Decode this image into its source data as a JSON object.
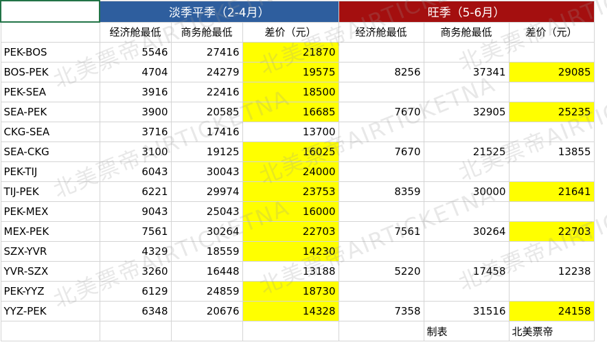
{
  "sheet": {
    "off_season_title": "淡季平季（2-4月）",
    "peak_season_title": "旺季（5-6月）",
    "headers": {
      "off": [
        "经济舱最低",
        "商务舱最低",
        "差价（元）"
      ],
      "peak": [
        "经济舱最低",
        "商务舱最低",
        "差价（元）"
      ]
    },
    "rows": [
      {
        "route": "PEK-BOS",
        "off": [
          "5546",
          "27416",
          "21870"
        ],
        "peak": [
          "",
          "",
          ""
        ]
      },
      {
        "route": "BOS-PEK",
        "off": [
          "4704",
          "24279",
          "19575"
        ],
        "peak": [
          "8256",
          "37341",
          "29085"
        ]
      },
      {
        "route": "PEK-SEA",
        "off": [
          "3916",
          "22416",
          "18500"
        ],
        "peak": [
          "",
          "",
          ""
        ]
      },
      {
        "route": "SEA-PEK",
        "off": [
          "3900",
          "20585",
          "16685"
        ],
        "peak": [
          "7670",
          "32905",
          "25235"
        ]
      },
      {
        "route": "CKG-SEA",
        "off": [
          "3716",
          "17416",
          "13700"
        ],
        "peak": [
          "",
          "",
          ""
        ]
      },
      {
        "route": "SEA-CKG",
        "off": [
          "3100",
          "19125",
          "16025"
        ],
        "peak": [
          "7670",
          "21525",
          "13855"
        ]
      },
      {
        "route": "PEK-TIJ",
        "off": [
          "6043",
          "30043",
          "24000"
        ],
        "peak": [
          "",
          "",
          ""
        ]
      },
      {
        "route": "TIJ-PEK",
        "off": [
          "6221",
          "29974",
          "23753"
        ],
        "peak": [
          "8359",
          "30000",
          "21641"
        ]
      },
      {
        "route": "PEK-MEX",
        "off": [
          "9043",
          "25043",
          "16000"
        ],
        "peak": [
          "",
          "",
          ""
        ]
      },
      {
        "route": "MEX-PEK",
        "off": [
          "7561",
          "30264",
          "22703"
        ],
        "peak": [
          "7561",
          "30264",
          "22703"
        ]
      },
      {
        "route": "SZX-YVR",
        "off": [
          "4329",
          "18559",
          "14230"
        ],
        "peak": [
          "",
          "",
          ""
        ]
      },
      {
        "route": "YVR-SZX",
        "off": [
          "3260",
          "16448",
          "13188"
        ],
        "peak": [
          "5220",
          "17458",
          "12238"
        ]
      },
      {
        "route": "PEK-YYZ",
        "off": [
          "6129",
          "24859",
          "18730"
        ],
        "peak": [
          "",
          "",
          ""
        ]
      },
      {
        "route": "YYZ-PEK",
        "off": [
          "6348",
          "20676",
          "14328"
        ],
        "peak": [
          "7358",
          "31516",
          "24158"
        ]
      }
    ],
    "footer": {
      "made_by_label": "制表",
      "maker": "北美票帝"
    },
    "highlight_color": "#ffff00",
    "off_header_color": "#2e5e9e",
    "peak_header_color": "#a40f0f"
  },
  "watermark": {
    "text": "北美票帝AIRTICKETNA"
  }
}
